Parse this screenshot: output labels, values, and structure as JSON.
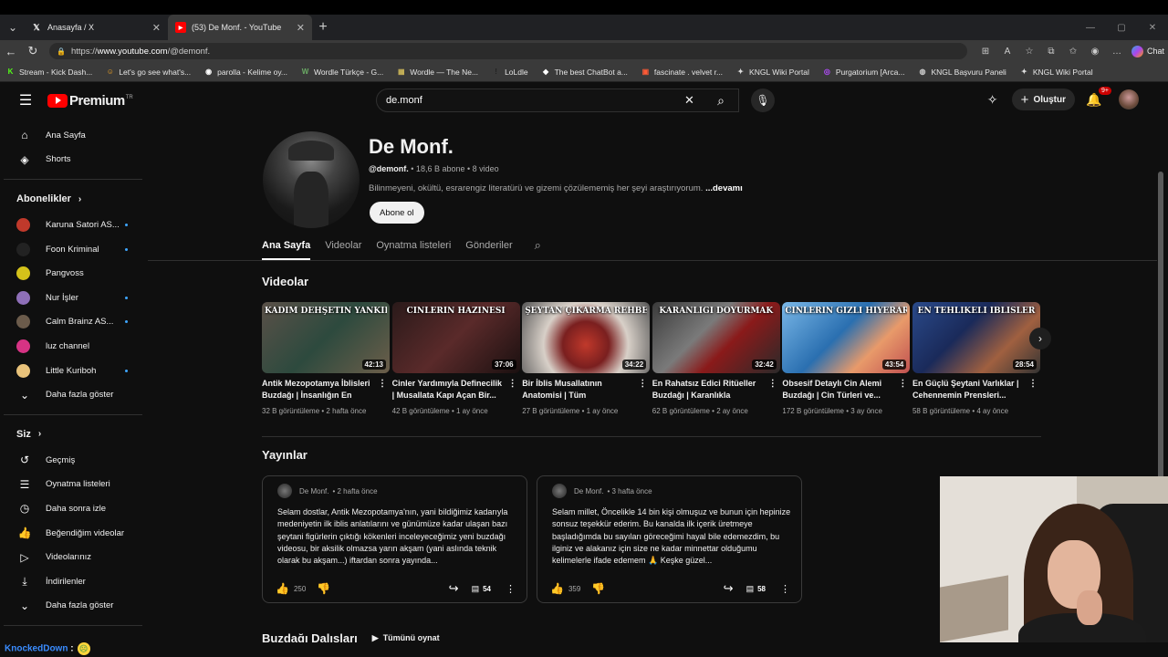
{
  "browser": {
    "tabs": [
      {
        "title": "Anasayfa / X",
        "icon": "x-logo-icon"
      },
      {
        "title": "(53) De Monf. - YouTube",
        "icon": "youtube-icon"
      }
    ],
    "url_prefix": "https://",
    "url_host": "www.youtube.com",
    "url_path": "/@demonf.",
    "chat_label": "Chat",
    "bookmarks": [
      {
        "label": "Stream - Kick Dash...",
        "icon": "K",
        "color": "#53fc18"
      },
      {
        "label": "Let's go see what's...",
        "icon": "☺",
        "color": "#f5a623"
      },
      {
        "label": "parolla - Kelime oy...",
        "icon": "◉",
        "color": "#ffffff"
      },
      {
        "label": "Wordle Türkçe - G...",
        "icon": "W",
        "color": "#6aaa64"
      },
      {
        "label": "Wordle — The Ne...",
        "icon": "▦",
        "color": "#c9b458"
      },
      {
        "label": "LoLdle",
        "icon": "!",
        "color": "#222222"
      },
      {
        "label": "The best ChatBot a...",
        "icon": "◆",
        "color": "#ffffff"
      },
      {
        "label": "fascinate . velvet r...",
        "icon": "▣",
        "color": "#ff5a36"
      },
      {
        "label": "KNGL Wiki Portal",
        "icon": "✦",
        "color": "#dddddd"
      },
      {
        "label": "Purgatorium [Arca...",
        "icon": "◎",
        "color": "#b44cff"
      },
      {
        "label": "KNGL Başvuru Paneli",
        "icon": "◍",
        "color": "#cccccc"
      },
      {
        "label": "KNGL Wiki Portal",
        "icon": "✦",
        "color": "#dddddd"
      }
    ]
  },
  "yt": {
    "logo_text": "Premium",
    "logo_region": "TR",
    "search_value": "de.monf",
    "create_label": "Oluştur",
    "notif_count": "9+"
  },
  "sidebar": {
    "main": [
      {
        "label": "Ana Sayfa",
        "icon": "home-icon"
      },
      {
        "label": "Shorts",
        "icon": "shorts-icon"
      }
    ],
    "subs_header": "Abonelikler",
    "subs": [
      {
        "label": "Karuna Satori AS...",
        "color": "#c0392b",
        "dot": true
      },
      {
        "label": "Foon Kriminal",
        "color": "#222222",
        "dot": true
      },
      {
        "label": "Pangvoss",
        "color": "#d4c21a",
        "dot": false
      },
      {
        "label": "Nur İşler",
        "color": "#8e6fb8",
        "dot": true
      },
      {
        "label": "Calm Brainz AS...",
        "color": "#6b5b4b",
        "dot": true
      },
      {
        "label": "luz channel",
        "color": "#d63384",
        "dot": false
      },
      {
        "label": "Little Kuriboh",
        "color": "#e8c27a",
        "dot": true
      }
    ],
    "subs_more": "Daha fazla göster",
    "you_header": "Siz",
    "you": [
      {
        "label": "Geçmiş",
        "icon": "history-icon"
      },
      {
        "label": "Oynatma listeleri",
        "icon": "playlists-icon"
      },
      {
        "label": "Daha sonra izle",
        "icon": "watch-later-icon"
      },
      {
        "label": "Beğendiğim videolar",
        "icon": "like-icon"
      },
      {
        "label": "Videolarınız",
        "icon": "your-videos-icon"
      },
      {
        "label": "İndirilenler",
        "icon": "download-icon"
      }
    ],
    "you_more": "Daha fazla göster"
  },
  "channel": {
    "name": "De Monf.",
    "handle": "@demonf.",
    "meta": " • 18,6 B abone • 8 video",
    "description": "Bilinmeyeni, okültü, esrarengiz literatürü ve gizemi çözülememiş her şeyi araştırıyorum.",
    "more": "...devamı",
    "subscribe": "Abone ol",
    "tabs": [
      "Ana Sayfa",
      "Videolar",
      "Oynatma listeleri",
      "Gönderiler"
    ]
  },
  "videos_section": {
    "title": "Videolar",
    "items": [
      {
        "thumb": "KADİM DEHŞETİN YANKILARI",
        "duration": "42:13",
        "title": "Antik Mezopotamya İblisleri Buzdağı | İnsanlığın En Eski...",
        "views": "32 B görüntüleme",
        "age": "2 hafta önce",
        "bg": "linear-gradient(135deg,#5a5048,#2d4a3e 50%,#6c5e4a)"
      },
      {
        "thumb": "CİNLERİN HAZİNESİ",
        "duration": "37:06",
        "title": "Cinler Yardımıyla Definecilik | Musallata Kapı Açan Bir...",
        "views": "42 B görüntüleme",
        "age": "1 ay önce",
        "bg": "linear-gradient(135deg,#2a1a1a,#5a2a2a 50%,#1a1010)"
      },
      {
        "thumb": "ŞEYTAN ÇIKARMA REHBERİ",
        "duration": "34:22",
        "title": "Bir İblis Musallatının Anatomisi | Tüm Detaylarıyl...",
        "views": "27 B görüntüleme",
        "age": "1 ay önce",
        "bg": "radial-gradient(circle at 50% 60%,#c0392b 0,#7a1f1f 30%,#d8d0c8 55%,#555 100%)"
      },
      {
        "thumb": "KARANLIĞI   DOYURMAK",
        "duration": "32:42",
        "title": "En Rahatsız Edici Ritüeller Buzdağı | Karanlıkla Yapılan...",
        "views": "62 B görüntüleme",
        "age": "2 ay önce",
        "bg": "linear-gradient(135deg,#3a3a3a,#7a7a7a 40%,#8a1a1a 60%,#2a2a2a)"
      },
      {
        "thumb": "CİNLERİN GİZLİ HİYERARŞİSİ",
        "duration": "43:54",
        "title": "Obsesif Detaylı Cin Alemi Buzdağı | Cin Türleri ve...",
        "views": "172 B görüntüleme",
        "age": "3 ay önce",
        "bg": "linear-gradient(135deg,#7ab8e8,#2a6fb0 45%,#e89a6a 70%,#c05050)"
      },
      {
        "thumb": "EN TEHLİKELİ İBLİSLER",
        "duration": "28:54",
        "title": "En Güçlü Şeytani Varlıklar | Cehennemin Prensleri...",
        "views": "58 B görüntüleme",
        "age": "4 ay önce",
        "bg": "linear-gradient(135deg,#2a4a8a,#1a2a5a 40%,#a06040 70%,#333)"
      }
    ]
  },
  "posts_section": {
    "title": "Yayınlar",
    "items": [
      {
        "author": "De Monf.",
        "age": "• 2 hafta önce",
        "text": "Selam dostlar, Antik Mezopotamya'nın, yani bildiğimiz kadarıyla medeniyetin ilk iblis anlatılarını ve günümüze kadar ulaşan bazı şeytani figürlerin çıktığı kökenleri inceleyeceğimiz yeni buzdağı videosu, bir aksilik olmazsa yarın akşam (yani aslında teknik olarak bu akşam...) iftardan sonra yayında...",
        "likes": "250",
        "comments": "54"
      },
      {
        "author": "De Monf.",
        "age": "• 3 hafta önce",
        "text": "Selam millet, Öncelikle 14 bin kişi olmuşuz ve bunun için hepinize sonsuz teşekkür ederim. Bu kanalda ilk içerik üretmeye başladığımda bu sayıları göreceğimi hayal bile edemezdim, bu ilginiz ve alakanız için size ne kadar minnettar olduğumu kelimelerle ifade edemem 🙏 Keşke güzel...",
        "likes": "359",
        "comments": "58"
      }
    ]
  },
  "next_section": {
    "title": "Buzdağı Dalışları",
    "play_all": "Tümünü oynat"
  },
  "status": {
    "user": "KnockedDown",
    "sep": ":"
  }
}
